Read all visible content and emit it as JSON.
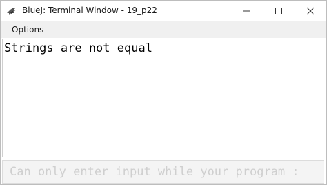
{
  "window": {
    "title": "BlueJ: Terminal Window - 19_p22"
  },
  "menubar": {
    "options_label": "Options"
  },
  "terminal": {
    "output_text": "Strings are not equal",
    "input_placeholder": "Can only enter input while your program :"
  },
  "icons": {
    "app": "bluej-bird-icon",
    "minimize": "minimize-icon",
    "maximize": "maximize-icon",
    "close": "close-icon"
  },
  "colors": {
    "menubar_bg": "#f0f0f0",
    "input_bg": "#f4f4f4",
    "placeholder_text": "#cfcfcf"
  }
}
